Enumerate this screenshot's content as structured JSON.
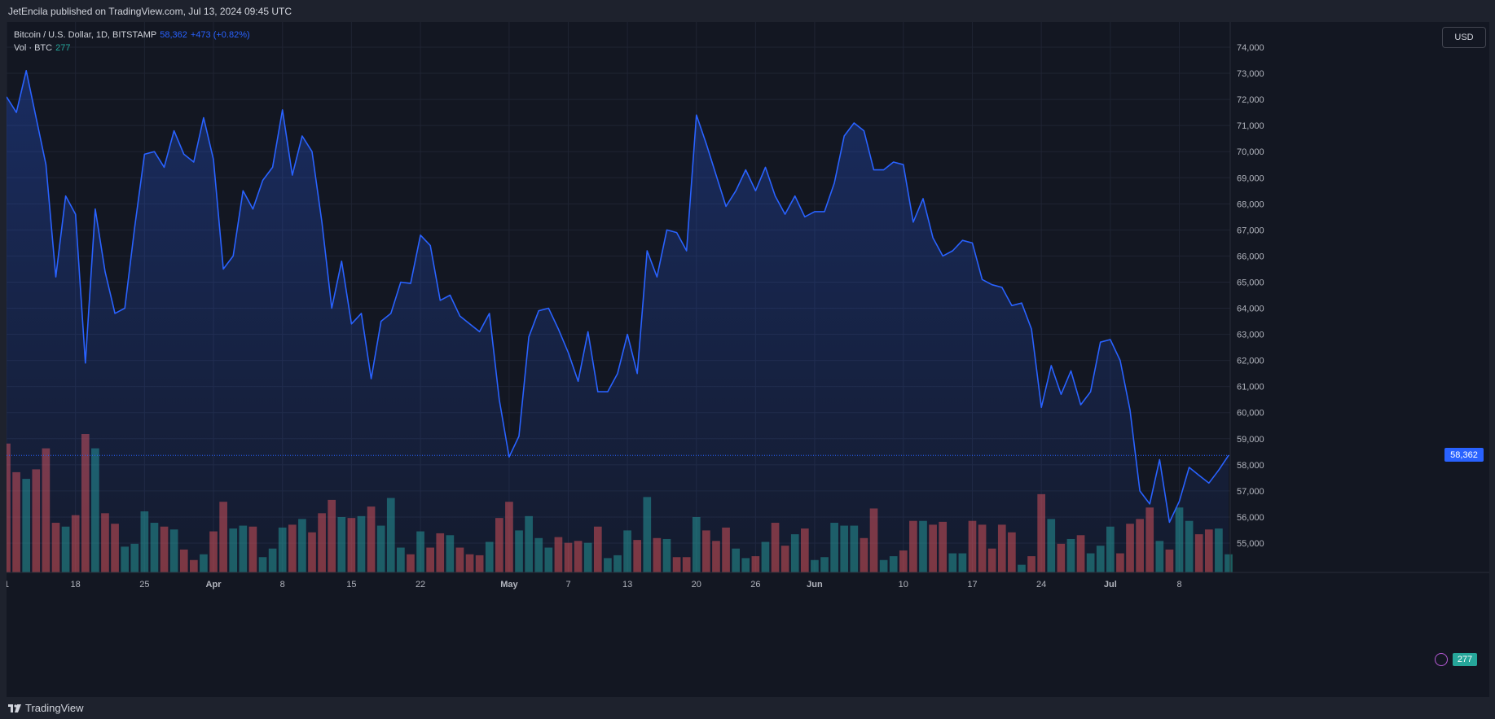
{
  "header": {
    "published": "JetEncila published on TradingView.com, Jul 13, 2024 09:45 UTC"
  },
  "legend": {
    "symbol": "Bitcoin / U.S. Dollar, 1D, BITSTAMP",
    "price": "58,362",
    "change": "+473 (+0.82%)",
    "volume_label": "Vol · BTC",
    "volume_value": "277"
  },
  "currency_button": "USD",
  "footer": {
    "brand": "TradingView"
  },
  "colors": {
    "line": "#2962ff",
    "up": "#26a69a",
    "down": "#ef5350",
    "background": "#131722"
  },
  "chart_data": {
    "type": "area",
    "ylim": [
      54000,
      74500
    ],
    "y_ticks": [
      "74,000",
      "73,000",
      "72,000",
      "71,000",
      "70,000",
      "69,000",
      "68,000",
      "67,000",
      "66,000",
      "65,000",
      "64,000",
      "63,000",
      "62,000",
      "61,000",
      "60,000",
      "59,000",
      "58,000",
      "57,000",
      "56,000",
      "55,000"
    ],
    "x_tick_labels": [
      {
        "label": "1",
        "index": 0
      },
      {
        "label": "18",
        "index": 7
      },
      {
        "label": "25",
        "index": 14
      },
      {
        "label": "Apr",
        "index": 21
      },
      {
        "label": "8",
        "index": 28
      },
      {
        "label": "15",
        "index": 35
      },
      {
        "label": "22",
        "index": 42
      },
      {
        "label": "May",
        "index": 51
      },
      {
        "label": "7",
        "index": 57
      },
      {
        "label": "13",
        "index": 63
      },
      {
        "label": "20",
        "index": 70
      },
      {
        "label": "26",
        "index": 76
      },
      {
        "label": "Jun",
        "index": 82
      },
      {
        "label": "10",
        "index": 91
      },
      {
        "label": "17",
        "index": 98
      },
      {
        "label": "24",
        "index": 105
      },
      {
        "label": "Jul",
        "index": 112
      },
      {
        "label": "8",
        "index": 119
      }
    ],
    "last_price": 58362,
    "last_price_label": "58,362",
    "last_volume_label": "277",
    "close": [
      72100,
      71500,
      73100,
      71300,
      69500,
      65200,
      68300,
      67600,
      61900,
      67800,
      65400,
      63800,
      64000,
      67100,
      69900,
      70000,
      69400,
      70800,
      69900,
      69600,
      71300,
      69700,
      65500,
      66000,
      68500,
      67800,
      68900,
      69400,
      71600,
      69100,
      70600,
      70000,
      67300,
      64000,
      65800,
      63400,
      63800,
      61300,
      63500,
      63800,
      65000,
      64950,
      66800,
      66400,
      64300,
      64500,
      63700,
      63400,
      63100,
      63800,
      60500,
      58300,
      59100,
      62900,
      63900,
      64000,
      63200,
      62300,
      61200,
      63100,
      60800,
      60800,
      61500,
      63000,
      61500,
      66200,
      65200,
      67000,
      66900,
      66200,
      71400,
      70300,
      69100,
      67900,
      68500,
      69300,
      68500,
      69400,
      68300,
      67600,
      68300,
      67500,
      67700,
      67700,
      68800,
      70600,
      71100,
      70800,
      69300,
      69300,
      69600,
      69500,
      67300,
      68200,
      66700,
      66000,
      66200,
      66600,
      66500,
      65100,
      64900,
      64800,
      64100,
      64200,
      63200,
      60200,
      61800,
      60700,
      61600,
      60300,
      60800,
      62700,
      62800,
      62000,
      60100,
      57000,
      56500,
      58200,
      55800,
      56600,
      57900,
      57600,
      57300,
      57800,
      58362
    ],
    "volume": [
      13.5,
      10.5,
      9.8,
      10.8,
      13.0,
      5.2,
      4.8,
      6.0,
      14.5,
      13.0,
      6.2,
      5.1,
      2.7,
      3.0,
      6.4,
      5.2,
      4.8,
      4.5,
      2.4,
      1.3,
      1.9,
      4.3,
      7.4,
      4.6,
      4.9,
      4.8,
      1.6,
      2.5,
      4.7,
      5.0,
      5.6,
      4.2,
      6.2,
      7.6,
      5.8,
      5.7,
      5.9,
      6.9,
      4.9,
      7.8,
      2.6,
      1.9,
      4.3,
      2.6,
      4.1,
      3.9,
      2.6,
      1.9,
      1.8,
      3.2,
      5.7,
      7.4,
      4.4,
      5.9,
      3.6,
      2.6,
      3.7,
      3.1,
      3.3,
      3.1,
      4.8,
      1.5,
      1.8,
      4.4,
      3.4,
      7.9,
      3.6,
      3.5,
      1.6,
      1.6,
      5.8,
      4.4,
      3.3,
      4.7,
      2.5,
      1.5,
      1.7,
      3.2,
      5.2,
      2.8,
      4.0,
      4.6,
      1.3,
      1.6,
      5.2,
      4.9,
      4.9,
      3.6,
      6.7,
      1.3,
      1.7,
      2.3,
      5.4,
      5.4,
      5.0,
      5.3,
      2.0,
      2.0,
      5.4,
      5.0,
      2.5,
      5.0,
      4.2,
      0.8,
      1.7,
      8.2,
      5.6,
      3.0,
      3.5,
      3.9,
      2.0,
      2.8,
      4.8,
      2.0,
      5.1,
      5.6,
      6.8,
      3.3,
      2.4,
      6.8,
      5.4,
      4.0,
      4.5,
      4.6,
      1.9
    ]
  }
}
